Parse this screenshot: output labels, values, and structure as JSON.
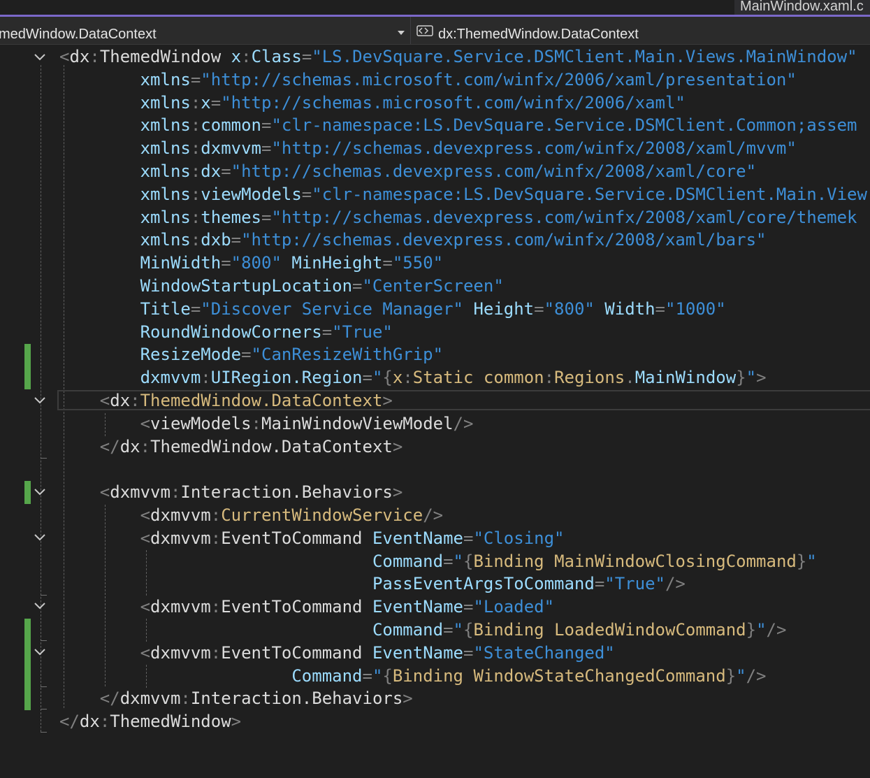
{
  "tab": {
    "title": "MainWindow.xaml.c"
  },
  "navbar": {
    "left_label": "medWindow.DataContext",
    "right_label": "dx:ThemedWindow.DataContext",
    "right_icon": "xaml-element-icon"
  },
  "colors": {
    "element": "#569cd6",
    "punctuation": "#808080",
    "attribute": "#9cdcfe",
    "string": "#3d8fd8",
    "markup_extension": "#d7ba7d",
    "change_marker": "#56a64b",
    "accent": "#7b68c9"
  },
  "code_lines": [
    {
      "tokens": [
        {
          "k": "p",
          "t": "<"
        },
        {
          "k": "w",
          "t": "dx"
        },
        {
          "k": "p",
          "t": ":"
        },
        {
          "k": "w",
          "t": "ThemedWindow"
        },
        {
          "k": "tx",
          "t": " "
        },
        {
          "k": "a",
          "t": "x"
        },
        {
          "k": "p",
          "t": ":"
        },
        {
          "k": "a",
          "t": "Class"
        },
        {
          "k": "p",
          "t": "="
        },
        {
          "k": "s",
          "t": "\"LS.DevSquare.Service.DSMClient.Main.Views.MainWindow\""
        }
      ]
    },
    {
      "tokens": [
        {
          "k": "tx",
          "t": "        "
        },
        {
          "k": "a",
          "t": "xmlns"
        },
        {
          "k": "p",
          "t": "="
        },
        {
          "k": "s",
          "t": "\"http://schemas.microsoft.com/winfx/2006/xaml/presentation\""
        }
      ]
    },
    {
      "tokens": [
        {
          "k": "tx",
          "t": "        "
        },
        {
          "k": "a",
          "t": "xmlns"
        },
        {
          "k": "p",
          "t": ":"
        },
        {
          "k": "a",
          "t": "x"
        },
        {
          "k": "p",
          "t": "="
        },
        {
          "k": "s",
          "t": "\"http://schemas.microsoft.com/winfx/2006/xaml\""
        }
      ]
    },
    {
      "tokens": [
        {
          "k": "tx",
          "t": "        "
        },
        {
          "k": "a",
          "t": "xmlns"
        },
        {
          "k": "p",
          "t": ":"
        },
        {
          "k": "a",
          "t": "common"
        },
        {
          "k": "p",
          "t": "="
        },
        {
          "k": "s",
          "t": "\"clr-namespace:LS.DevSquare.Service.DSMClient.Common;assem"
        }
      ]
    },
    {
      "tokens": [
        {
          "k": "tx",
          "t": "        "
        },
        {
          "k": "a",
          "t": "xmlns"
        },
        {
          "k": "p",
          "t": ":"
        },
        {
          "k": "a",
          "t": "dxmvvm"
        },
        {
          "k": "p",
          "t": "="
        },
        {
          "k": "s",
          "t": "\"http://schemas.devexpress.com/winfx/2008/xaml/mvvm\""
        }
      ]
    },
    {
      "tokens": [
        {
          "k": "tx",
          "t": "        "
        },
        {
          "k": "a",
          "t": "xmlns"
        },
        {
          "k": "p",
          "t": ":"
        },
        {
          "k": "a",
          "t": "dx"
        },
        {
          "k": "p",
          "t": "="
        },
        {
          "k": "s",
          "t": "\"http://schemas.devexpress.com/winfx/2008/xaml/core\""
        }
      ]
    },
    {
      "tokens": [
        {
          "k": "tx",
          "t": "        "
        },
        {
          "k": "a",
          "t": "xmlns"
        },
        {
          "k": "p",
          "t": ":"
        },
        {
          "k": "a",
          "t": "viewModels"
        },
        {
          "k": "p",
          "t": "="
        },
        {
          "k": "s",
          "t": "\"clr-namespace:LS.DevSquare.Service.DSMClient.Main.View"
        }
      ]
    },
    {
      "tokens": [
        {
          "k": "tx",
          "t": "        "
        },
        {
          "k": "a",
          "t": "xmlns"
        },
        {
          "k": "p",
          "t": ":"
        },
        {
          "k": "a",
          "t": "themes"
        },
        {
          "k": "p",
          "t": "="
        },
        {
          "k": "s",
          "t": "\"http://schemas.devexpress.com/winfx/2008/xaml/core/themek"
        }
      ]
    },
    {
      "tokens": [
        {
          "k": "tx",
          "t": "        "
        },
        {
          "k": "a",
          "t": "xmlns"
        },
        {
          "k": "p",
          "t": ":"
        },
        {
          "k": "a",
          "t": "dxb"
        },
        {
          "k": "p",
          "t": "="
        },
        {
          "k": "s",
          "t": "\"http://schemas.devexpress.com/winfx/2008/xaml/bars\""
        }
      ]
    },
    {
      "tokens": [
        {
          "k": "tx",
          "t": "        "
        },
        {
          "k": "a",
          "t": "MinWidth"
        },
        {
          "k": "p",
          "t": "="
        },
        {
          "k": "s",
          "t": "\"800\""
        },
        {
          "k": "tx",
          "t": " "
        },
        {
          "k": "a",
          "t": "MinHeight"
        },
        {
          "k": "p",
          "t": "="
        },
        {
          "k": "s",
          "t": "\"550\""
        }
      ]
    },
    {
      "tokens": [
        {
          "k": "tx",
          "t": "        "
        },
        {
          "k": "a",
          "t": "WindowStartupLocation"
        },
        {
          "k": "p",
          "t": "="
        },
        {
          "k": "s",
          "t": "\"CenterScreen\""
        }
      ]
    },
    {
      "tokens": [
        {
          "k": "tx",
          "t": "        "
        },
        {
          "k": "a",
          "t": "Title"
        },
        {
          "k": "p",
          "t": "="
        },
        {
          "k": "s",
          "t": "\"Discover Service Manager\""
        },
        {
          "k": "tx",
          "t": " "
        },
        {
          "k": "a",
          "t": "Height"
        },
        {
          "k": "p",
          "t": "="
        },
        {
          "k": "s",
          "t": "\"800\""
        },
        {
          "k": "tx",
          "t": " "
        },
        {
          "k": "a",
          "t": "Width"
        },
        {
          "k": "p",
          "t": "="
        },
        {
          "k": "s",
          "t": "\"1000\""
        }
      ]
    },
    {
      "tokens": [
        {
          "k": "tx",
          "t": "        "
        },
        {
          "k": "a",
          "t": "RoundWindowCorners"
        },
        {
          "k": "p",
          "t": "="
        },
        {
          "k": "s",
          "t": "\"True\""
        }
      ]
    },
    {
      "tokens": [
        {
          "k": "tx",
          "t": "        "
        },
        {
          "k": "a",
          "t": "ResizeMode"
        },
        {
          "k": "p",
          "t": "="
        },
        {
          "k": "s",
          "t": "\"CanResizeWithGrip\""
        }
      ]
    },
    {
      "tokens": [
        {
          "k": "tx",
          "t": "        "
        },
        {
          "k": "a",
          "t": "dxmvvm"
        },
        {
          "k": "p",
          "t": ":"
        },
        {
          "k": "a",
          "t": "UIRegion.Region"
        },
        {
          "k": "p",
          "t": "="
        },
        {
          "k": "s",
          "t": "\""
        },
        {
          "k": "p",
          "t": "{"
        },
        {
          "k": "m",
          "t": "x"
        },
        {
          "k": "p",
          "t": ":"
        },
        {
          "k": "m",
          "t": "Static"
        },
        {
          "k": "tx",
          "t": " "
        },
        {
          "k": "m",
          "t": "common"
        },
        {
          "k": "p",
          "t": ":"
        },
        {
          "k": "m",
          "t": "Regions"
        },
        {
          "k": "p",
          "t": "."
        },
        {
          "k": "a",
          "t": "MainWindow"
        },
        {
          "k": "p",
          "t": "}"
        },
        {
          "k": "s",
          "t": "\""
        },
        {
          "k": "p",
          "t": ">"
        }
      ]
    },
    {
      "tokens": [
        {
          "k": "tx",
          "t": "    "
        },
        {
          "k": "p",
          "t": "<"
        },
        {
          "k": "w",
          "t": "dx"
        },
        {
          "k": "p",
          "t": ":"
        },
        {
          "k": "m",
          "t": "ThemedWindow.DataContext"
        },
        {
          "k": "p",
          "t": ">"
        }
      ]
    },
    {
      "tokens": [
        {
          "k": "tx",
          "t": "        "
        },
        {
          "k": "p",
          "t": "<"
        },
        {
          "k": "w",
          "t": "viewModels"
        },
        {
          "k": "p",
          "t": ":"
        },
        {
          "k": "w",
          "t": "MainWindowViewModel"
        },
        {
          "k": "p",
          "t": "/>"
        }
      ]
    },
    {
      "tokens": [
        {
          "k": "tx",
          "t": "    "
        },
        {
          "k": "p",
          "t": "</"
        },
        {
          "k": "w",
          "t": "dx"
        },
        {
          "k": "p",
          "t": ":"
        },
        {
          "k": "w",
          "t": "ThemedWindow.DataContext"
        },
        {
          "k": "p",
          "t": ">"
        }
      ]
    },
    {
      "tokens": []
    },
    {
      "tokens": [
        {
          "k": "tx",
          "t": "    "
        },
        {
          "k": "p",
          "t": "<"
        },
        {
          "k": "w",
          "t": "dxmvvm"
        },
        {
          "k": "p",
          "t": ":"
        },
        {
          "k": "w",
          "t": "Interaction.Behaviors"
        },
        {
          "k": "p",
          "t": ">"
        }
      ]
    },
    {
      "tokens": [
        {
          "k": "tx",
          "t": "        "
        },
        {
          "k": "p",
          "t": "<"
        },
        {
          "k": "w",
          "t": "dxmvvm"
        },
        {
          "k": "p",
          "t": ":"
        },
        {
          "k": "m",
          "t": "CurrentWindowService"
        },
        {
          "k": "p",
          "t": "/>"
        }
      ]
    },
    {
      "tokens": [
        {
          "k": "tx",
          "t": "        "
        },
        {
          "k": "p",
          "t": "<"
        },
        {
          "k": "w",
          "t": "dxmvvm"
        },
        {
          "k": "p",
          "t": ":"
        },
        {
          "k": "w",
          "t": "EventToCommand"
        },
        {
          "k": "tx",
          "t": " "
        },
        {
          "k": "a",
          "t": "EventName"
        },
        {
          "k": "p",
          "t": "="
        },
        {
          "k": "s",
          "t": "\"Closing\""
        }
      ]
    },
    {
      "tokens": [
        {
          "k": "tx",
          "t": "                               "
        },
        {
          "k": "a",
          "t": "Command"
        },
        {
          "k": "p",
          "t": "="
        },
        {
          "k": "s",
          "t": "\""
        },
        {
          "k": "p",
          "t": "{"
        },
        {
          "k": "m",
          "t": "Binding"
        },
        {
          "k": "tx",
          "t": " "
        },
        {
          "k": "m",
          "t": "MainWindowClosingCommand"
        },
        {
          "k": "p",
          "t": "}"
        },
        {
          "k": "s",
          "t": "\""
        }
      ]
    },
    {
      "tokens": [
        {
          "k": "tx",
          "t": "                               "
        },
        {
          "k": "a",
          "t": "PassEventArgsToCommand"
        },
        {
          "k": "p",
          "t": "="
        },
        {
          "k": "s",
          "t": "\"True\""
        },
        {
          "k": "p",
          "t": "/>"
        }
      ]
    },
    {
      "tokens": [
        {
          "k": "tx",
          "t": "        "
        },
        {
          "k": "p",
          "t": "<"
        },
        {
          "k": "w",
          "t": "dxmvvm"
        },
        {
          "k": "p",
          "t": ":"
        },
        {
          "k": "w",
          "t": "EventToCommand"
        },
        {
          "k": "tx",
          "t": " "
        },
        {
          "k": "a",
          "t": "EventName"
        },
        {
          "k": "p",
          "t": "="
        },
        {
          "k": "s",
          "t": "\"Loaded\""
        }
      ]
    },
    {
      "tokens": [
        {
          "k": "tx",
          "t": "                               "
        },
        {
          "k": "a",
          "t": "Command"
        },
        {
          "k": "p",
          "t": "="
        },
        {
          "k": "s",
          "t": "\""
        },
        {
          "k": "p",
          "t": "{"
        },
        {
          "k": "m",
          "t": "Binding"
        },
        {
          "k": "tx",
          "t": " "
        },
        {
          "k": "m",
          "t": "LoadedWindowCommand"
        },
        {
          "k": "p",
          "t": "}"
        },
        {
          "k": "s",
          "t": "\""
        },
        {
          "k": "p",
          "t": "/>"
        }
      ]
    },
    {
      "tokens": [
        {
          "k": "tx",
          "t": "        "
        },
        {
          "k": "p",
          "t": "<"
        },
        {
          "k": "w",
          "t": "dxmvvm"
        },
        {
          "k": "p",
          "t": ":"
        },
        {
          "k": "w",
          "t": "EventToCommand"
        },
        {
          "k": "tx",
          "t": " "
        },
        {
          "k": "a",
          "t": "EventName"
        },
        {
          "k": "p",
          "t": "="
        },
        {
          "k": "s",
          "t": "\"StateChanged\""
        }
      ]
    },
    {
      "tokens": [
        {
          "k": "tx",
          "t": "                       "
        },
        {
          "k": "a",
          "t": "Command"
        },
        {
          "k": "p",
          "t": "="
        },
        {
          "k": "s",
          "t": "\""
        },
        {
          "k": "p",
          "t": "{"
        },
        {
          "k": "m",
          "t": "Binding"
        },
        {
          "k": "tx",
          "t": " "
        },
        {
          "k": "m",
          "t": "WindowStateChangedCommand"
        },
        {
          "k": "p",
          "t": "}"
        },
        {
          "k": "s",
          "t": "\""
        },
        {
          "k": "p",
          "t": "/>"
        }
      ]
    },
    {
      "tokens": [
        {
          "k": "tx",
          "t": "    "
        },
        {
          "k": "p",
          "t": "</"
        },
        {
          "k": "w",
          "t": "dxmvvm"
        },
        {
          "k": "p",
          "t": ":"
        },
        {
          "k": "w",
          "t": "Interaction.Behaviors"
        },
        {
          "k": "p",
          "t": ">"
        }
      ]
    },
    {
      "tokens": [
        {
          "k": "p",
          "t": "</"
        },
        {
          "k": "w",
          "t": "dx"
        },
        {
          "k": "p",
          "t": ":"
        },
        {
          "k": "w",
          "t": "ThemedWindow"
        },
        {
          "k": "p",
          "t": ">"
        }
      ]
    }
  ]
}
